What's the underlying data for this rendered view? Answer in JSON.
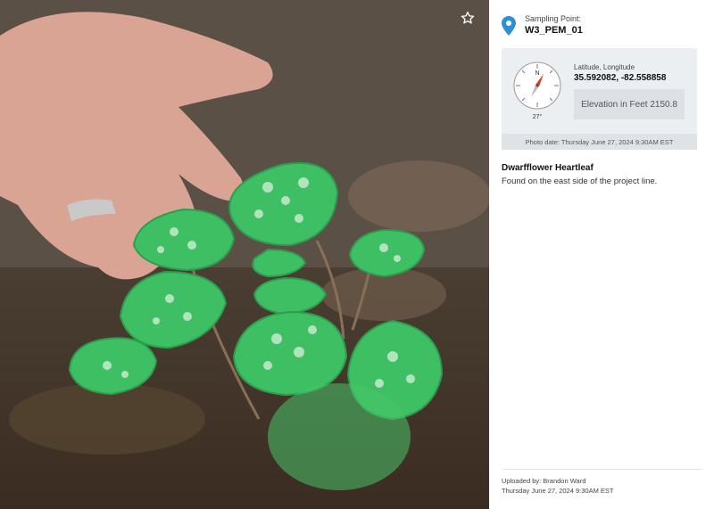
{
  "photo": {
    "icon": "star-icon",
    "star_tooltip": "Favorite",
    "colors": {
      "leaf": "#3dbb62",
      "vein": "#d8f0dc",
      "soil": "#4a3a2c"
    }
  },
  "sampling": {
    "label": "Sampling Point:",
    "value": "W3_PEM_01",
    "icon": "location-pin-icon",
    "accent": "#2f8fd6"
  },
  "geo": {
    "heading_degrees": "27°",
    "latlon_label": "Latitude, Longitude",
    "latlon_value": "35.592082, -82.558858",
    "elevation": "Elevation in Feet 2150.8",
    "photo_date": "Photo date: Thursday June 27, 2024 9:30AM EST"
  },
  "observation": {
    "species": "Dwarfflower Heartleaf",
    "note": "Found on the east side of the project line."
  },
  "upload": {
    "by": "Uploaded by: Brandon Ward",
    "date": "Thursday June 27, 2024 9:30AM EST"
  }
}
